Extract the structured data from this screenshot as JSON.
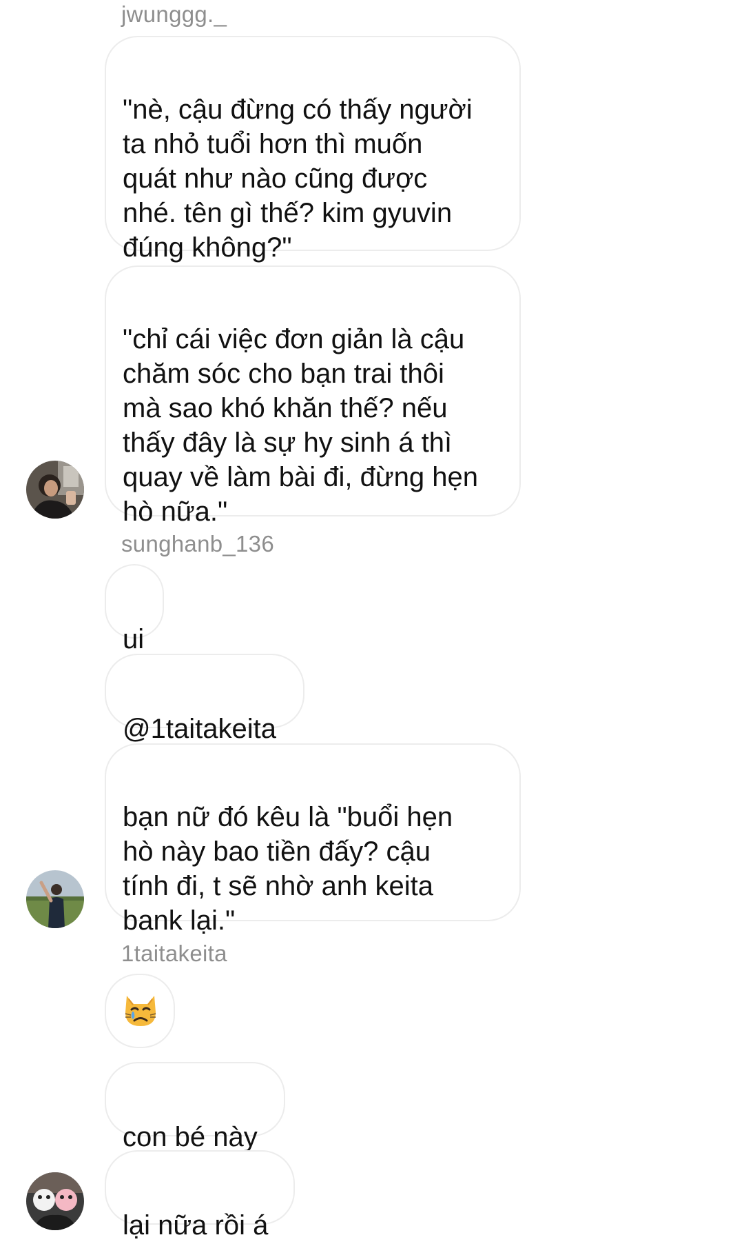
{
  "messages": [
    {
      "sender": "jwunggg._",
      "text": "\"nè, cậu đừng có thấy người\nta nhỏ tuổi hơn thì muốn\nquát như nào cũng được\nnhé. tên gì thế? kim gyuvin\nđúng không?\""
    },
    {
      "text": "\"chỉ cái việc đơn giản là cậu\nchăm sóc cho bạn trai thôi\nmà sao khó khăn thế? nếu\nthấy đây là sự hy sinh á thì\nquay về làm bài đi, đừng hẹn\nhò nữa.\""
    },
    {
      "sender": "sunghanb_136",
      "text": "ui"
    },
    {
      "text": "@1taitakeita"
    },
    {
      "text": "bạn nữ đó kêu là \"buổi hẹn\nhò này bao tiền đấy? cậu\ntính đi, t sẽ nhờ anh keita\nbank lại.\""
    },
    {
      "sender": "1taitakeita",
      "emoji": "crying-cat-face"
    },
    {
      "text": "con bé này"
    },
    {
      "text": "lại nữa rồi á"
    }
  ],
  "colors": {
    "bubble_border": "#ececec",
    "username": "#8e8e8e",
    "text": "#111111",
    "cat_face": "#f6b93b"
  }
}
